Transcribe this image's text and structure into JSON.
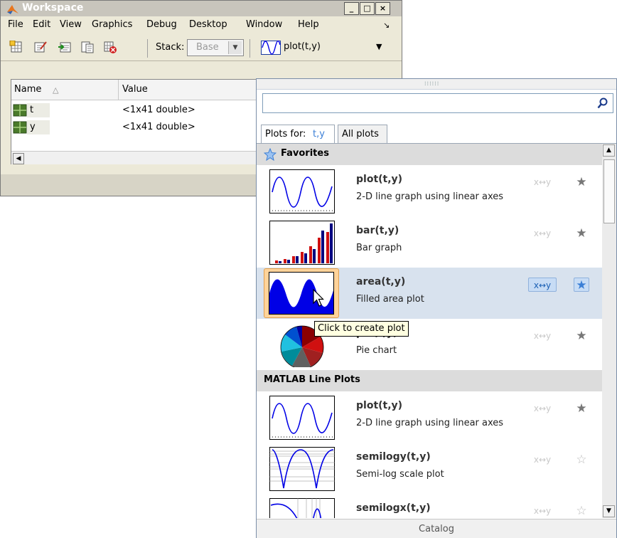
{
  "workspace": {
    "title": "Workspace",
    "menus": [
      "File",
      "Edit",
      "View",
      "Graphics",
      "Debug",
      "Desktop",
      "Window",
      "Help"
    ],
    "stack_label": "Stack:",
    "stack_value": "Base",
    "plot_button_label": "plot(t,y)",
    "columns": [
      "Name",
      "Value"
    ],
    "sort_indicator": "△",
    "variables": [
      {
        "name": "t",
        "value": "<1x41 double>"
      },
      {
        "name": "y",
        "value": "<1x41 double>"
      }
    ]
  },
  "catalog": {
    "search_placeholder": "",
    "tabs": {
      "plots_for_label": "Plots for:",
      "plots_for_vars": "t,y",
      "all_plots": "All plots"
    },
    "sections": [
      {
        "title": "Favorites",
        "items": [
          {
            "func": "plot(t,y)",
            "desc": "2-D line graph using linear axes",
            "swap": "x↔y",
            "star": "★",
            "thumb": "line-plot-thumbnail"
          },
          {
            "func": "bar(t,y)",
            "desc": "Bar graph",
            "swap": "x↔y",
            "star": "★",
            "thumb": "bar-plot-thumbnail"
          },
          {
            "func": "area(t,y)",
            "desc": "Filled area plot",
            "swap": "x↔y",
            "star": "★",
            "thumb": "area-plot-thumbnail"
          },
          {
            "func": "pie(t,y)",
            "desc": "Pie chart",
            "swap": "x↔y",
            "star": "★",
            "thumb": "pie-plot-thumbnail"
          }
        ]
      },
      {
        "title": "MATLAB Line Plots",
        "items": [
          {
            "func": "plot(t,y)",
            "desc": "2-D line graph using linear axes",
            "swap": "x↔y",
            "star": "★",
            "thumb": "line-plot-thumbnail"
          },
          {
            "func": "semilogy(t,y)",
            "desc": "Semi-log scale plot",
            "swap": "x↔y",
            "star": "☆",
            "thumb": "semilogy-plot-thumbnail"
          },
          {
            "func": "semilogx(t,y)",
            "desc": "",
            "swap": "x↔y",
            "star": "☆",
            "thumb": "semilogx-plot-thumbnail"
          }
        ]
      }
    ],
    "tooltip": "Click to create plot",
    "footer": "Catalog"
  },
  "colors": {
    "accent": "#3b7fd6",
    "highlight_row": "#d8e2ee",
    "selected_thumb": "#ffd39a",
    "plot_blue": "#0000e6"
  }
}
